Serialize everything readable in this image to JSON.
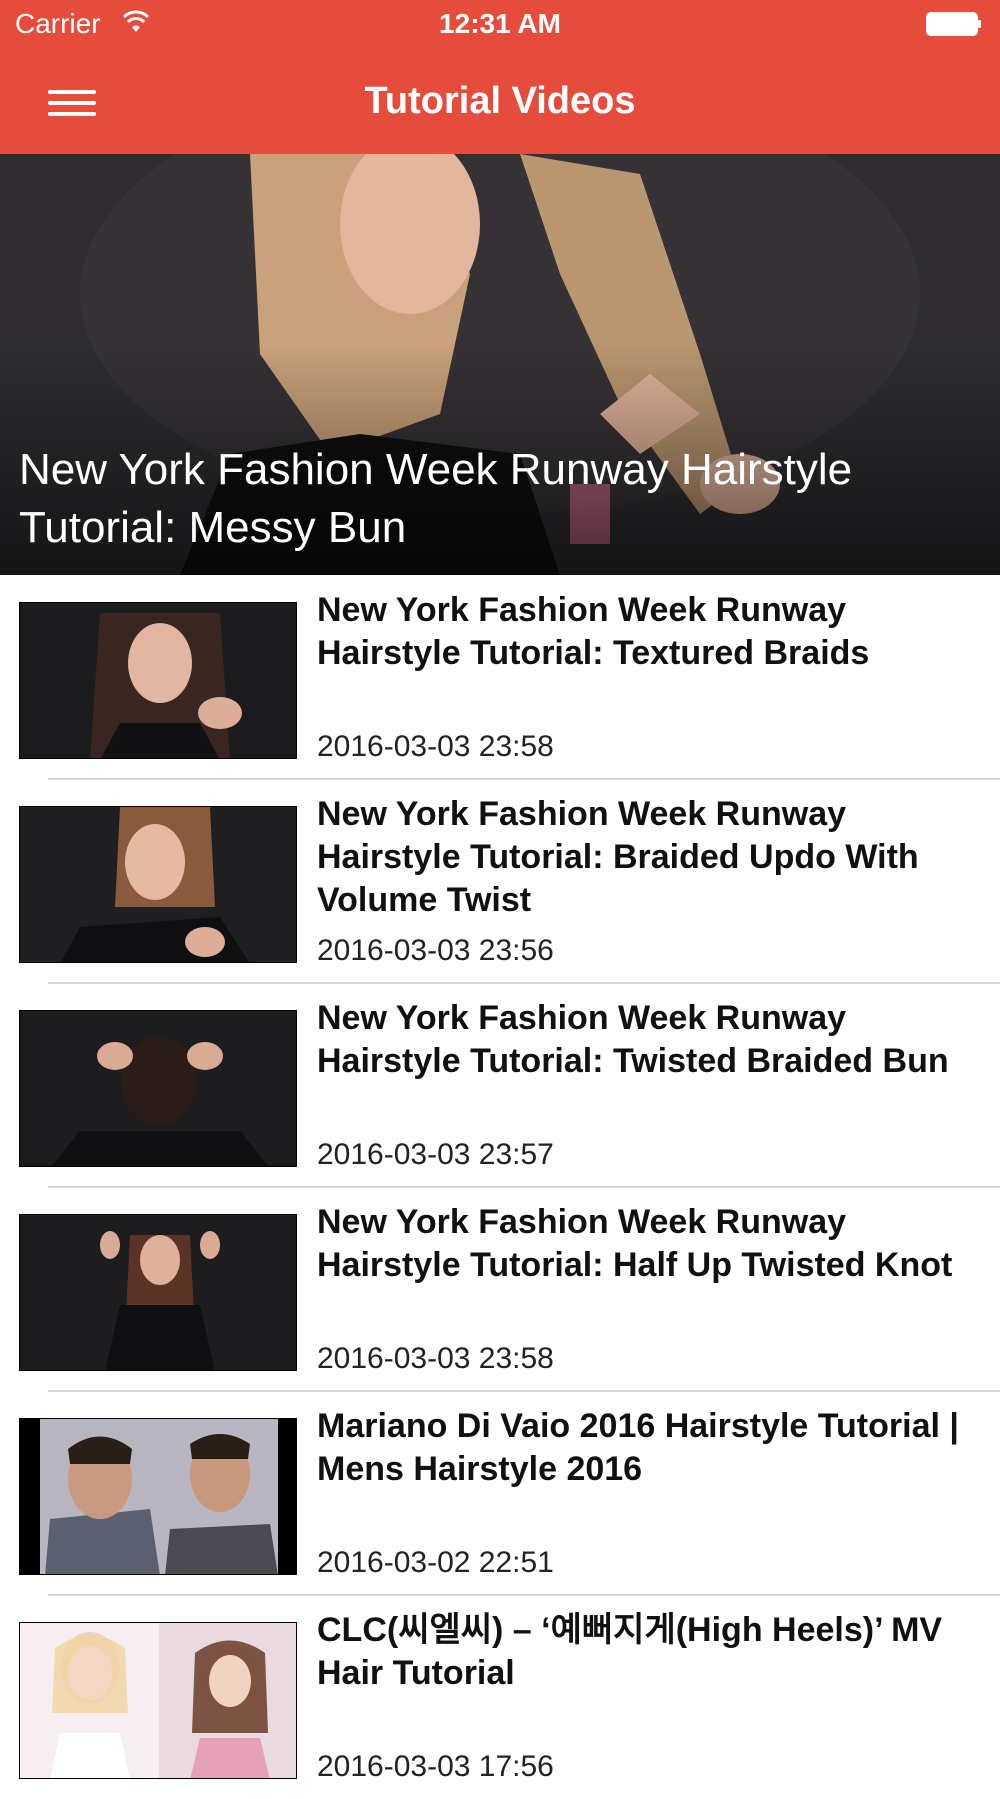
{
  "status": {
    "carrier": "Carrier",
    "time": "12:31 AM"
  },
  "nav": {
    "title": "Tutorial Videos",
    "menu_icon": "hamburger-menu-icon"
  },
  "colors": {
    "accent": "#e64c3c",
    "text": "#111111",
    "separator": "#d8d8d8"
  },
  "featured": {
    "title": "New York Fashion Week Runway Hairstyle Tutorial: Messy Bun"
  },
  "videos": [
    {
      "title": "New York Fashion Week Runway Hairstyle Tutorial: Textured Braids",
      "date": "2016-03-03 23:58"
    },
    {
      "title": "New York Fashion Week Runway Hairstyle Tutorial: Braided Updo With Volume Twist",
      "date": "2016-03-03 23:56"
    },
    {
      "title": "New York Fashion Week Runway Hairstyle Tutorial: Twisted Braided Bun",
      "date": "2016-03-03 23:57"
    },
    {
      "title": "New York Fashion Week Runway Hairstyle Tutorial: Half Up Twisted Knot",
      "date": "2016-03-03 23:58"
    },
    {
      "title": "Mariano Di Vaio 2016 Hairstyle Tutorial | Mens Hairstyle 2016",
      "date": "2016-03-02 22:51"
    },
    {
      "title": "CLC(씨엘씨) – ‘예뻐지게(High Heels)’ MV Hair Tutorial",
      "date": "2016-03-03 17:56"
    }
  ]
}
